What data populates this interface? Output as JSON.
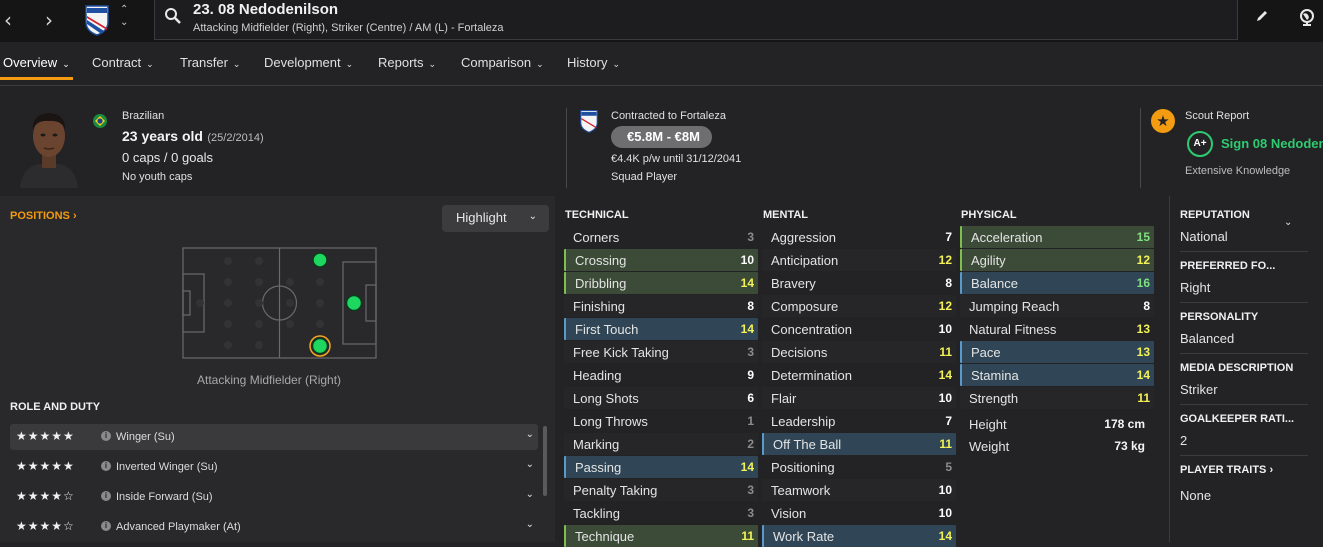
{
  "header": {
    "player_name": "23. 08 Nedodenilson",
    "positions_line": "Attacking Midfielder (Right), Striker (Centre) / AM (L) - Fortaleza"
  },
  "tabs": [
    {
      "label": "Overview"
    },
    {
      "label": "Contract"
    },
    {
      "label": "Transfer"
    },
    {
      "label": "Development"
    },
    {
      "label": "Reports"
    },
    {
      "label": "Comparison"
    },
    {
      "label": "History"
    }
  ],
  "bio": {
    "nationality": "Brazilian",
    "age": "23 years old",
    "dob": "(25/2/2014)",
    "caps": "0 caps / 0 goals",
    "youth": "No youth caps"
  },
  "contract": {
    "status": "Contracted to Fortaleza",
    "value": "€5.8M - €8M",
    "wage": "€4.4K p/w until 31/12/2041",
    "role": "Squad Player"
  },
  "scout": {
    "title": "Scout Report",
    "grade": "A+",
    "recommendation": "Sign 08 Nedoden",
    "knowledge": "Extensive Knowledge"
  },
  "left": {
    "positions_label": "POSITIONS",
    "highlight_label": "Highlight",
    "position_name": "Attacking Midfielder (Right)",
    "role_title": "ROLE AND DUTY",
    "roles": [
      {
        "stars": "★★★★★",
        "name": "Winger (Su)"
      },
      {
        "stars": "★★★★★",
        "name": "Inverted Winger (Su)"
      },
      {
        "stars": "★★★★☆",
        "name": "Inside Forward (Su)"
      },
      {
        "stars": "★★★★☆",
        "name": "Advanced Playmaker (At)"
      }
    ]
  },
  "attributes": {
    "technical_title": "TECHNICAL",
    "technical": [
      {
        "n": "Corners",
        "v": "3"
      },
      {
        "n": "Crossing",
        "v": "10"
      },
      {
        "n": "Dribbling",
        "v": "14"
      },
      {
        "n": "Finishing",
        "v": "8"
      },
      {
        "n": "First Touch",
        "v": "14"
      },
      {
        "n": "Free Kick Taking",
        "v": "3"
      },
      {
        "n": "Heading",
        "v": "9"
      },
      {
        "n": "Long Shots",
        "v": "6"
      },
      {
        "n": "Long Throws",
        "v": "1"
      },
      {
        "n": "Marking",
        "v": "2"
      },
      {
        "n": "Passing",
        "v": "14"
      },
      {
        "n": "Penalty Taking",
        "v": "3"
      },
      {
        "n": "Tackling",
        "v": "3"
      },
      {
        "n": "Technique",
        "v": "11"
      }
    ],
    "mental_title": "MENTAL",
    "mental": [
      {
        "n": "Aggression",
        "v": "7"
      },
      {
        "n": "Anticipation",
        "v": "12"
      },
      {
        "n": "Bravery",
        "v": "8"
      },
      {
        "n": "Composure",
        "v": "12"
      },
      {
        "n": "Concentration",
        "v": "10"
      },
      {
        "n": "Decisions",
        "v": "11"
      },
      {
        "n": "Determination",
        "v": "14"
      },
      {
        "n": "Flair",
        "v": "10"
      },
      {
        "n": "Leadership",
        "v": "7"
      },
      {
        "n": "Off The Ball",
        "v": "11"
      },
      {
        "n": "Positioning",
        "v": "5"
      },
      {
        "n": "Teamwork",
        "v": "10"
      },
      {
        "n": "Vision",
        "v": "10"
      },
      {
        "n": "Work Rate",
        "v": "14"
      }
    ],
    "physical_title": "PHYSICAL",
    "physical": [
      {
        "n": "Acceleration",
        "v": "15"
      },
      {
        "n": "Agility",
        "v": "12"
      },
      {
        "n": "Balance",
        "v": "16"
      },
      {
        "n": "Jumping Reach",
        "v": "8"
      },
      {
        "n": "Natural Fitness",
        "v": "13"
      },
      {
        "n": "Pace",
        "v": "13"
      },
      {
        "n": "Stamina",
        "v": "14"
      },
      {
        "n": "Strength",
        "v": "11"
      }
    ],
    "height_label": "Height",
    "height": "178 cm",
    "weight_label": "Weight",
    "weight": "73 kg"
  },
  "right": [
    {
      "title": "REPUTATION",
      "value": "National"
    },
    {
      "title": "PREFERRED FO...",
      "value": "Right"
    },
    {
      "title": "PERSONALITY",
      "value": "Balanced"
    },
    {
      "title": "MEDIA DESCRIPTION",
      "value": "Striker"
    },
    {
      "title": "GOALKEEPER RATI...",
      "value": "2"
    },
    {
      "title": "PLAYER TRAITS",
      "value": "None"
    }
  ],
  "colors": {
    "accent": "#f39c12",
    "highlight_green": "#7fbf4d",
    "highlight_blue": "#5a9ac8",
    "scout_green": "#2ecc71"
  }
}
